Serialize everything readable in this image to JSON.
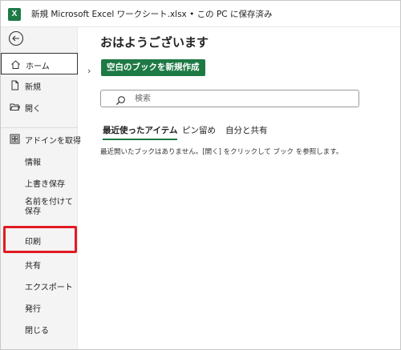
{
  "window": {
    "app_icon_letter": "X",
    "title": "新規 Microsoft Excel ワークシート.xlsx • この PC に保存済み"
  },
  "sidebar": {
    "back_icon": "back-arrow-icon",
    "items": [
      {
        "label": "ホーム",
        "icon": "home-icon"
      },
      {
        "label": "新規",
        "icon": "new-document-icon"
      },
      {
        "label": "開く",
        "icon": "open-folder-icon"
      },
      {
        "label": "アドインを取得",
        "icon": "addins-grid-icon"
      },
      {
        "label": "情報"
      },
      {
        "label": "上書き保存"
      },
      {
        "label": "名前を付けて保存"
      },
      {
        "label": "印刷"
      },
      {
        "label": "共有"
      },
      {
        "label": "エクスポート"
      },
      {
        "label": "発行"
      },
      {
        "label": "閉じる"
      }
    ]
  },
  "main": {
    "greeting": "おはようございます",
    "new_blank_book": "空白のブックを新規作成",
    "search": {
      "placeholder": "検索"
    },
    "tabs": [
      {
        "label": "最近使ったアイテム",
        "active": true
      },
      {
        "label": "ピン留め",
        "active": false
      },
      {
        "label": "自分と共有",
        "active": false
      }
    ],
    "empty_message": "最近開いたブックはありません。[開く] をクリックして ブック を参照します。"
  },
  "colors": {
    "accent": "#1e7a45",
    "highlight": "#e21b23"
  }
}
